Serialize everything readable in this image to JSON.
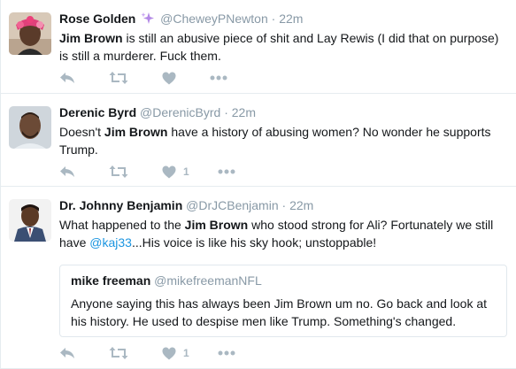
{
  "tweets": [
    {
      "fullname": "Rose Golden",
      "username": "@CheweyPNewton",
      "time": "22m",
      "text_parts": {
        "b1": "Jim Brown",
        "t1": " is still an abusive piece of shit and Lay Rewis (I did that on purpose) is still a murderer. Fuck them."
      },
      "actions": {
        "reply": "reply-icon",
        "retweet": "retweet-icon",
        "like_count": "",
        "more": "more-icon"
      }
    },
    {
      "fullname": "Derenic Byrd",
      "username": "@DerenicByrd",
      "time": "22m",
      "text_parts": {
        "t0": "Doesn't ",
        "b1": "Jim Brown",
        "t1": " have a history of abusing women? No wonder he supports Trump."
      },
      "actions": {
        "like_count": "1"
      }
    },
    {
      "fullname": "Dr. Johnny Benjamin",
      "username": "@DrJCBenjamin",
      "time": "22m",
      "text_parts": {
        "t0": "What happened to the ",
        "b1": "Jim Brown",
        "t1": " who stood strong for Ali? Fortunately we still have ",
        "mention": "@kaj33",
        "t2": "...His voice is like his sky hook; unstoppable!"
      },
      "quote": {
        "fullname": "mike freeman",
        "username": "@mikefreemanNFL",
        "text": "Anyone saying this has always been Jim Brown um no. Go back and look at his history. He used to despise men like Trump. Something's changed."
      },
      "actions": {
        "like_count": "1"
      }
    }
  ],
  "separator": "·",
  "colors": {
    "link": "#1b95e0",
    "muted": "#8899a6",
    "icon": "#aab8c2"
  }
}
